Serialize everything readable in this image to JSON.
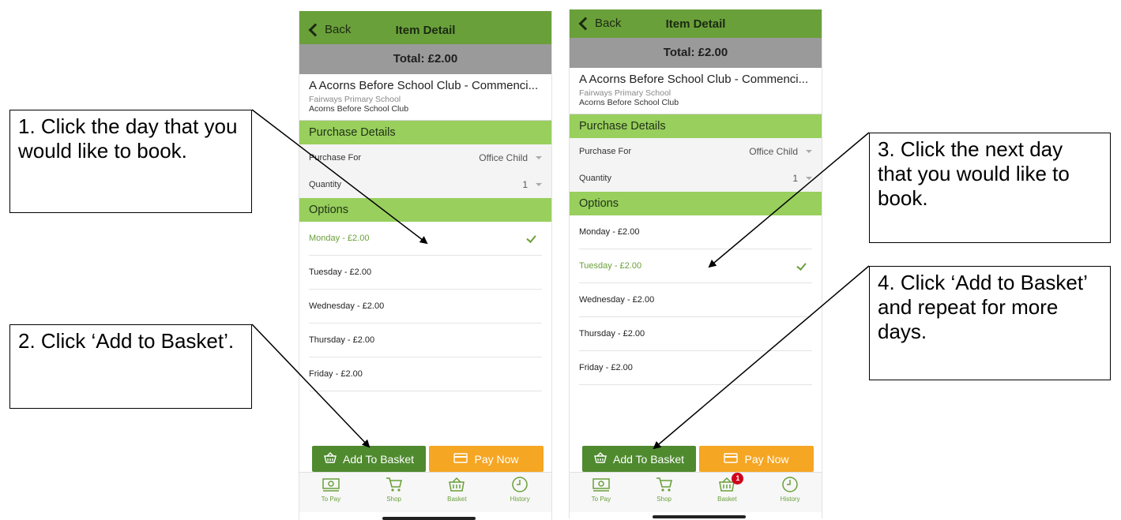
{
  "screens": [
    {
      "nav": {
        "back_label": "Back",
        "title": "Item Detail"
      },
      "total": "Total: £2.00",
      "item": {
        "title": "A Acorns Before School Club - Commenci...",
        "school": "Fairways Primary School",
        "club": "Acorns Before School Club"
      },
      "purchase_details": {
        "heading": "Purchase Details",
        "purchase_for_label": "Purchase For",
        "purchase_for_value": "Office Child",
        "quantity_label": "Quantity",
        "quantity_value": "1"
      },
      "options": {
        "heading": "Options",
        "items": [
          {
            "label": "Monday - £2.00",
            "selected": true
          },
          {
            "label": "Tuesday - £2.00",
            "selected": false
          },
          {
            "label": "Wednesday - £2.00",
            "selected": false
          },
          {
            "label": "Thursday - £2.00",
            "selected": false
          },
          {
            "label": "Friday - £2.00",
            "selected": false
          }
        ]
      },
      "buttons": {
        "add_to_basket": "Add To Basket",
        "pay_now": "Pay Now"
      },
      "tabs": [
        {
          "label": "To Pay",
          "icon": "banknote-icon"
        },
        {
          "label": "Shop",
          "icon": "cart-icon"
        },
        {
          "label": "Basket",
          "icon": "basket-icon"
        },
        {
          "label": "History",
          "icon": "clock-icon"
        }
      ],
      "basket_badge": ""
    },
    {
      "nav": {
        "back_label": "Back",
        "title": "Item Detail"
      },
      "total": "Total: £2.00",
      "item": {
        "title": "A Acorns Before School Club - Commenci...",
        "school": "Fairways Primary School",
        "club": "Acorns Before School Club"
      },
      "purchase_details": {
        "heading": "Purchase Details",
        "purchase_for_label": "Purchase For",
        "purchase_for_value": "Office Child",
        "quantity_label": "Quantity",
        "quantity_value": "1"
      },
      "options": {
        "heading": "Options",
        "items": [
          {
            "label": "Monday - £2.00",
            "selected": false
          },
          {
            "label": "Tuesday - £2.00",
            "selected": true
          },
          {
            "label": "Wednesday - £2.00",
            "selected": false
          },
          {
            "label": "Thursday - £2.00",
            "selected": false
          },
          {
            "label": "Friday - £2.00",
            "selected": false
          }
        ]
      },
      "buttons": {
        "add_to_basket": "Add To Basket",
        "pay_now": "Pay Now"
      },
      "tabs": [
        {
          "label": "To Pay",
          "icon": "banknote-icon"
        },
        {
          "label": "Shop",
          "icon": "cart-icon"
        },
        {
          "label": "Basket",
          "icon": "basket-icon"
        },
        {
          "label": "History",
          "icon": "clock-icon"
        }
      ],
      "basket_badge": "1"
    }
  ],
  "callouts": [
    "1. Click the day that you would like to book.",
    "2. Click ‘Add to Basket’.",
    "3. Click the next day that you would like to book.",
    "4. Click ‘Add to Basket’ and repeat for more days."
  ],
  "colors": {
    "nav_green": "#6aa03a",
    "section_green": "#98cf5d",
    "add_button": "#4f8a2f",
    "pay_button": "#f5a623",
    "total_bar": "#9a9a9a",
    "badge": "#d0021b"
  }
}
